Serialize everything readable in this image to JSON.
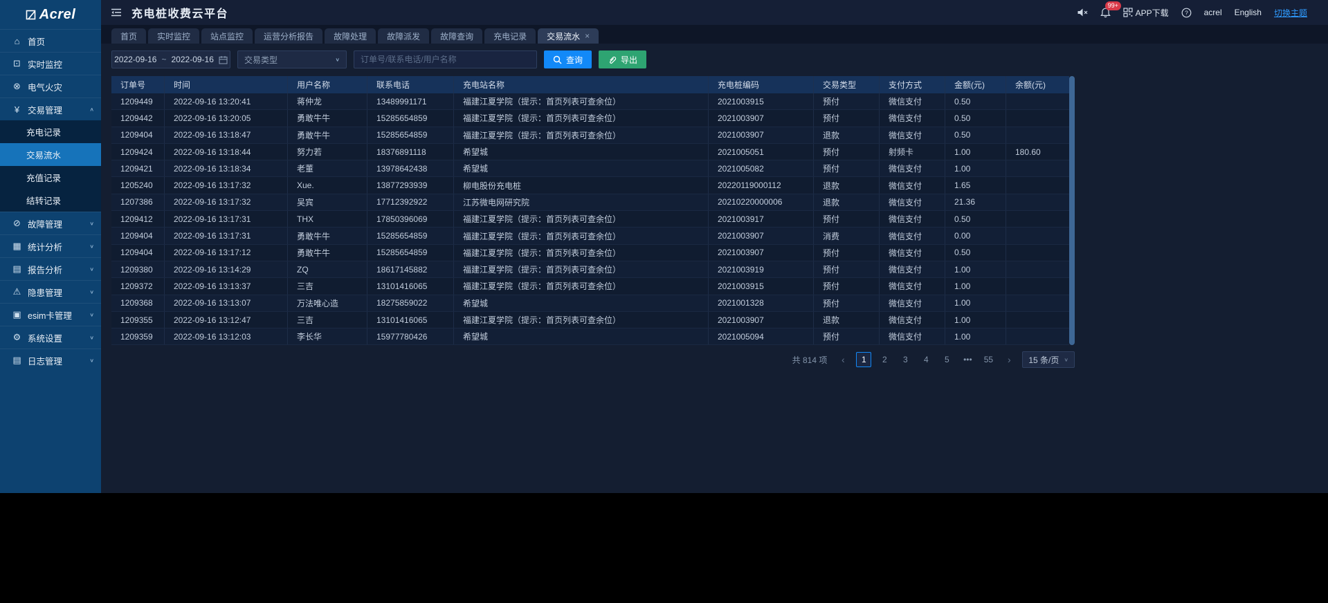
{
  "app": {
    "title": "充电桩收费云平台"
  },
  "sidebar": {
    "logo_text": "Acrel",
    "items": [
      {
        "label": "首页",
        "icon": "home-icon",
        "glyph": "⌂"
      },
      {
        "label": "实时监控",
        "icon": "monitor-icon",
        "glyph": "⊡"
      },
      {
        "label": "电气火灾",
        "icon": "electric-fire-icon",
        "glyph": "⊗"
      },
      {
        "label": "交易管理",
        "icon": "transaction-icon",
        "glyph": "¥",
        "expanded": true,
        "children": [
          {
            "label": "充电记录"
          },
          {
            "label": "交易流水",
            "active": true
          },
          {
            "label": "充值记录"
          },
          {
            "label": "结转记录"
          }
        ]
      },
      {
        "label": "故障管理",
        "icon": "fault-icon",
        "glyph": "⊘",
        "collapsible": true
      },
      {
        "label": "统计分析",
        "icon": "stats-icon",
        "glyph": "▦",
        "collapsible": true
      },
      {
        "label": "报告分析",
        "icon": "report-icon",
        "glyph": "▤",
        "collapsible": true
      },
      {
        "label": "隐患管理",
        "icon": "hazard-icon",
        "glyph": "⚠",
        "collapsible": true
      },
      {
        "label": "esim卡管理",
        "icon": "esim-card-icon",
        "glyph": "▣",
        "collapsible": true
      },
      {
        "label": "系统设置",
        "icon": "settings-icon",
        "glyph": "⚙",
        "collapsible": true
      },
      {
        "label": "日志管理",
        "icon": "log-icon",
        "glyph": "▤",
        "collapsible": true
      }
    ]
  },
  "topbar": {
    "app_download": "APP下载",
    "notification_badge": "99+",
    "username": "acrel",
    "language": "English",
    "theme_switch": "切换主题"
  },
  "tabs": {
    "items": [
      "首页",
      "实时监控",
      "站点监控",
      "运营分析报告",
      "故障处理",
      "故障派发",
      "故障查询",
      "充电记录",
      "交易流水"
    ],
    "active": "交易流水",
    "close_glyph": "×"
  },
  "filters": {
    "date_start": "2022-09-16",
    "date_separator": "~",
    "date_end": "2022-09-16",
    "type_placeholder": "交易类型",
    "search_placeholder": "订单号/联系电话/用户名称",
    "query_label": "查询",
    "export_label": "导出"
  },
  "table": {
    "columns": [
      "订单号",
      "时间",
      "用户名称",
      "联系电话",
      "充电站名称",
      "充电桩编码",
      "交易类型",
      "支付方式",
      "金额(元)",
      "余额(元)"
    ],
    "rows": [
      [
        "1209449",
        "2022-09-16 13:20:41",
        "蒋仲龙",
        "13489991171",
        "福建江夏学院（提示：首页列表可查余位）",
        "2021003915",
        "预付",
        "微信支付",
        "0.50",
        ""
      ],
      [
        "1209442",
        "2022-09-16 13:20:05",
        "勇敢牛牛",
        "15285654859",
        "福建江夏学院（提示：首页列表可查余位）",
        "2021003907",
        "预付",
        "微信支付",
        "0.50",
        ""
      ],
      [
        "1209404",
        "2022-09-16 13:18:47",
        "勇敢牛牛",
        "15285654859",
        "福建江夏学院（提示：首页列表可查余位）",
        "2021003907",
        "退款",
        "微信支付",
        "0.50",
        ""
      ],
      [
        "1209424",
        "2022-09-16 13:18:44",
        "努力若",
        "18376891118",
        "希望城",
        "2021005051",
        "预付",
        "射频卡",
        "1.00",
        "180.60"
      ],
      [
        "1209421",
        "2022-09-16 13:18:34",
        "老董",
        "13978642438",
        "希望城",
        "2021005082",
        "预付",
        "微信支付",
        "1.00",
        ""
      ],
      [
        "1205240",
        "2022-09-16 13:17:32",
        "Xue.",
        "13877293939",
        "柳电股份充电桩",
        "20220119000112",
        "退款",
        "微信支付",
        "1.65",
        ""
      ],
      [
        "1207386",
        "2022-09-16 13:17:32",
        "吴宾",
        "17712392922",
        "江苏微电网研究院",
        "20210220000006",
        "退款",
        "微信支付",
        "21.36",
        ""
      ],
      [
        "1209412",
        "2022-09-16 13:17:31",
        "THX",
        "17850396069",
        "福建江夏学院（提示：首页列表可查余位）",
        "2021003917",
        "预付",
        "微信支付",
        "0.50",
        ""
      ],
      [
        "1209404",
        "2022-09-16 13:17:31",
        "勇敢牛牛",
        "15285654859",
        "福建江夏学院（提示：首页列表可查余位）",
        "2021003907",
        "消费",
        "微信支付",
        "0.00",
        ""
      ],
      [
        "1209404",
        "2022-09-16 13:17:12",
        "勇敢牛牛",
        "15285654859",
        "福建江夏学院（提示：首页列表可查余位）",
        "2021003907",
        "预付",
        "微信支付",
        "0.50",
        ""
      ],
      [
        "1209380",
        "2022-09-16 13:14:29",
        "ZQ",
        "18617145882",
        "福建江夏学院（提示：首页列表可查余位）",
        "2021003919",
        "预付",
        "微信支付",
        "1.00",
        ""
      ],
      [
        "1209372",
        "2022-09-16 13:13:37",
        "三吉",
        "13101416065",
        "福建江夏学院（提示：首页列表可查余位）",
        "2021003915",
        "预付",
        "微信支付",
        "1.00",
        ""
      ],
      [
        "1209368",
        "2022-09-16 13:13:07",
        "万法唯心造",
        "18275859022",
        "希望城",
        "2021001328",
        "预付",
        "微信支付",
        "1.00",
        ""
      ],
      [
        "1209355",
        "2022-09-16 13:12:47",
        "三吉",
        "13101416065",
        "福建江夏学院（提示：首页列表可查余位）",
        "2021003907",
        "退款",
        "微信支付",
        "1.00",
        ""
      ],
      [
        "1209359",
        "2022-09-16 13:12:03",
        "李长华",
        "15977780426",
        "希望城",
        "2021005094",
        "预付",
        "微信支付",
        "1.00",
        ""
      ]
    ]
  },
  "pagination": {
    "total": "共 814 项",
    "prev_glyph": "‹",
    "next_glyph": "›",
    "pages": [
      "1",
      "2",
      "3",
      "4",
      "5",
      "•••",
      "55"
    ],
    "active_page": "1",
    "page_size": "15 条/页",
    "chevron_glyph": "∨"
  }
}
